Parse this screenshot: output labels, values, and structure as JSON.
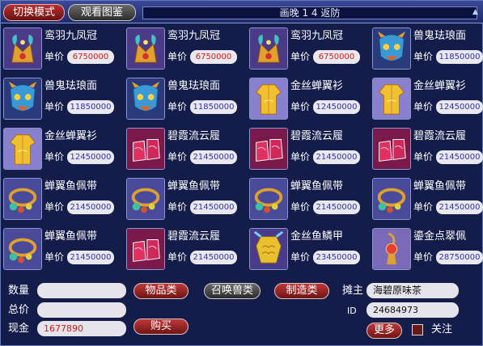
{
  "header": {
    "switch_mode": "切换模式",
    "view_gallery": "观看图鉴",
    "title": "画晚 1 4 返防"
  },
  "price_label": "单价",
  "items": [
    {
      "name": "鸾羽九凤冠",
      "price": "6750000",
      "price_color": "#d81818",
      "icon": "phoenix-crown-icon"
    },
    {
      "name": "鸾羽九凤冠",
      "price": "6750000",
      "price_color": "#d81818",
      "icon": "phoenix-crown-icon"
    },
    {
      "name": "鸾羽九凤冠",
      "price": "6750000",
      "price_color": "#d81818",
      "icon": "phoenix-crown-icon"
    },
    {
      "name": "兽鬼珐琅面",
      "price": "11850000",
      "price_color": "#3030b8",
      "icon": "beast-mask-icon"
    },
    {
      "name": "兽鬼珐琅面",
      "price": "11850000",
      "price_color": "#3030b8",
      "icon": "beast-mask-icon"
    },
    {
      "name": "兽鬼珐琅面",
      "price": "11850000",
      "price_color": "#3030b8",
      "icon": "beast-mask-icon"
    },
    {
      "name": "金丝蝉翼衫",
      "price": "12450000",
      "price_color": "#3030b8",
      "icon": "golden-robe-icon"
    },
    {
      "name": "金丝蝉翼衫",
      "price": "12450000",
      "price_color": "#3030b8",
      "icon": "golden-robe-icon"
    },
    {
      "name": "金丝蝉翼衫",
      "price": "12450000",
      "price_color": "#3030b8",
      "icon": "golden-robe-icon"
    },
    {
      "name": "碧霞流云履",
      "price": "21450000",
      "price_color": "#3030b8",
      "icon": "cloud-boots-icon"
    },
    {
      "name": "碧霞流云履",
      "price": "21450000",
      "price_color": "#3030b8",
      "icon": "cloud-boots-icon"
    },
    {
      "name": "碧霞流云履",
      "price": "21450000",
      "price_color": "#3030b8",
      "icon": "cloud-boots-icon"
    },
    {
      "name": "蝉翼鱼佩带",
      "price": "21450000",
      "price_color": "#3030b8",
      "icon": "jade-belt-icon"
    },
    {
      "name": "蝉翼鱼佩带",
      "price": "21450000",
      "price_color": "#3030b8",
      "icon": "jade-belt-icon"
    },
    {
      "name": "蝉翼鱼佩带",
      "price": "21450000",
      "price_color": "#3030b8",
      "icon": "jade-belt-icon"
    },
    {
      "name": "蝉翼鱼佩带",
      "price": "21450000",
      "price_color": "#3030b8",
      "icon": "jade-belt-icon"
    },
    {
      "name": "蝉翼鱼佩带",
      "price": "21450000",
      "price_color": "#3030b8",
      "icon": "jade-belt-icon"
    },
    {
      "name": "碧霞流云履",
      "price": "21450000",
      "price_color": "#3030b8",
      "icon": "cloud-boots-icon"
    },
    {
      "name": "金丝鱼鳞甲",
      "price": "23450000",
      "price_color": "#3030b8",
      "icon": "fish-scale-armor-icon"
    },
    {
      "name": "鎏金点翠佩",
      "price": "28750000",
      "price_color": "#3030b8",
      "icon": "gilded-pendant-icon"
    }
  ],
  "bottom": {
    "quantity_label": "数量",
    "quantity_value": "",
    "total_label": "总价",
    "total_value": "",
    "cash_label": "现金",
    "cash_value": "1677890",
    "cash_color": "#d81818",
    "tab_goods": "物品类",
    "tab_summon": "召唤兽类",
    "tab_crafting": "制造类",
    "buy": "购买",
    "owner_label": "摊主",
    "owner_value": "海碧原味茶",
    "id_label": "ID",
    "id_value": "24684973",
    "more": "更多",
    "follow": "关注"
  }
}
